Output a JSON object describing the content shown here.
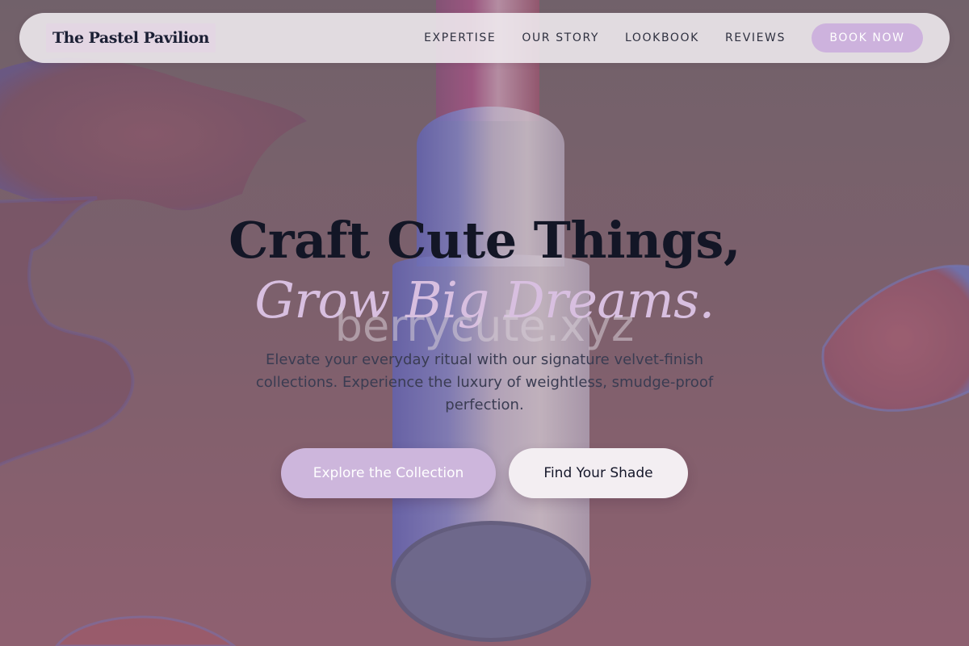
{
  "brand": {
    "name": "The Pastel Pavilion"
  },
  "nav": {
    "links": [
      "EXPERTISE",
      "OUR STORY",
      "LOOKBOOK",
      "REVIEWS"
    ],
    "cta": "BOOK NOW"
  },
  "hero": {
    "headline_line1": "Craft Cute Things,",
    "headline_line2": "Grow Big Dreams.",
    "watermark": "berrycute.xyz",
    "subtext": "Elevate your everyday ritual with our signature velvet-finish collections. Experience the luxury of weightless, smudge-proof perfection.",
    "primary_cta": "Explore the Collection",
    "secondary_cta": "Find Your Shade"
  },
  "colors": {
    "accent": "#cdb2dd",
    "headline": "#131626",
    "headline_italic": "#d8bfe0",
    "nav_bg": "#f0ecf0"
  },
  "background": {
    "image": "lipstick-product-photo"
  }
}
